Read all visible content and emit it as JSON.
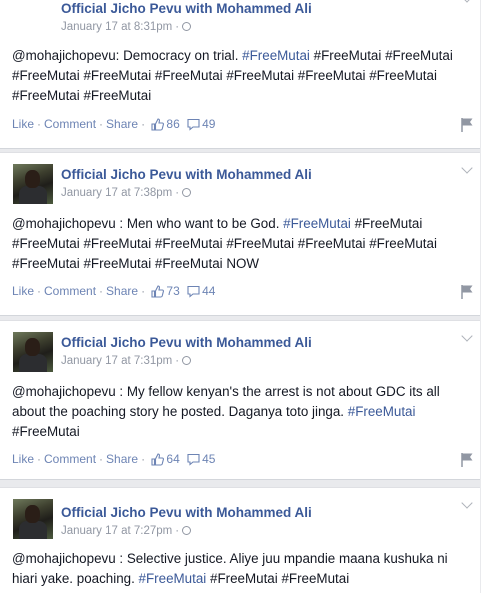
{
  "posts": [
    {
      "author": "Official Jicho Pevu with Mohammed Ali",
      "date": "January 17 at 8:31pm",
      "text_segments": [
        {
          "t": "@mohajichopevu: Democracy on trial. ",
          "tag": false
        },
        {
          "t": "#FreeMutai",
          "tag": true
        },
        {
          "t": " #FreeMutai #FreeMutai #FreeMutai #FreeMutai #FreeMutai #FreeMutai #FreeMutai #FreeMutai #FreeMutai #FreeMutai",
          "tag": false
        }
      ],
      "like_label": "Like",
      "comment_label": "Comment",
      "share_label": "Share",
      "likes": "86",
      "comments": "49"
    },
    {
      "author": "Official Jicho Pevu with Mohammed Ali",
      "date": "January 17 at 7:38pm",
      "text_segments": [
        {
          "t": "@mohajichopevu : Men who want to be God. ",
          "tag": false
        },
        {
          "t": "#FreeMutai",
          "tag": true
        },
        {
          "t": " #FreeMutai #FreeMutai #FreeMutai #FreeMutai #FreeMutai #FreeMutai #FreeMutai #FreeMutai #FreeMutai #FreeMutai NOW",
          "tag": false
        }
      ],
      "like_label": "Like",
      "comment_label": "Comment",
      "share_label": "Share",
      "likes": "73",
      "comments": "44"
    },
    {
      "author": "Official Jicho Pevu with Mohammed Ali",
      "date": "January 17 at 7:31pm",
      "text_segments": [
        {
          "t": "@mohajichopevu : My fellow kenyan's the arrest is not about GDC its all about the poaching story he posted. Daganya toto jinga. ",
          "tag": false
        },
        {
          "t": "#FreeMutai",
          "tag": true
        },
        {
          "t": " #FreeMutai",
          "tag": false
        }
      ],
      "like_label": "Like",
      "comment_label": "Comment",
      "share_label": "Share",
      "likes": "64",
      "comments": "45"
    },
    {
      "author": "Official Jicho Pevu with Mohammed Ali",
      "date": "January 17 at 7:27pm",
      "text_segments": [
        {
          "t": "@mohajichopevu : Selective justice. Aliye juu mpandie maana kushuka ni hiari yake. poaching. ",
          "tag": false
        },
        {
          "t": "#FreeMutai",
          "tag": true
        },
        {
          "t": " #FreeMutai #FreeMutai",
          "tag": false
        }
      ]
    }
  ],
  "icons": {
    "avatar": "avatar",
    "privacy": "globe-icon",
    "options": "chevron-down-icon",
    "likes": "thumbs-up-icon",
    "comments": "comment-icon",
    "flag": "flag-icon"
  },
  "colors": {
    "link": "#3b5998",
    "meta": "#9197a3",
    "action": "#6d84b4",
    "background": "#e9eaed"
  }
}
